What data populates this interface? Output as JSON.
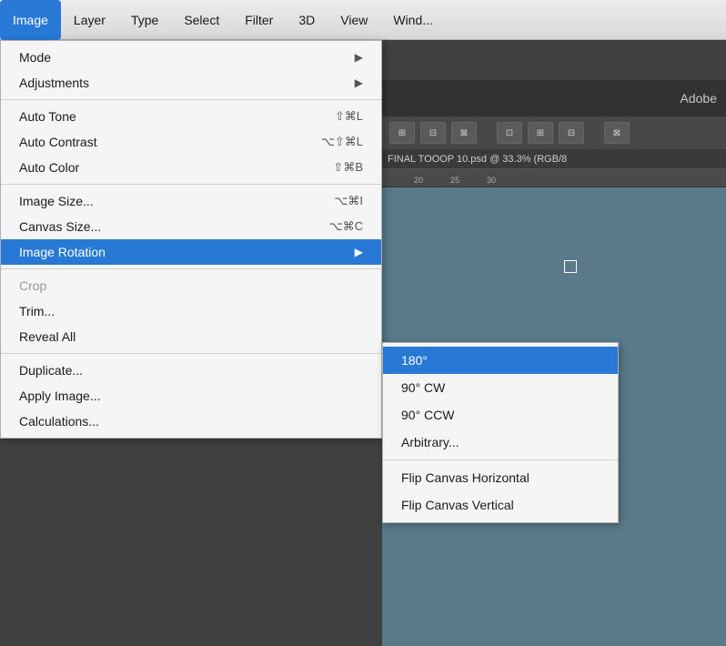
{
  "menubar": {
    "items": [
      {
        "label": "Image",
        "active": true
      },
      {
        "label": "Layer",
        "active": false
      },
      {
        "label": "Type",
        "active": false
      },
      {
        "label": "Select",
        "active": false
      },
      {
        "label": "Filter",
        "active": false
      },
      {
        "label": "3D",
        "active": false
      },
      {
        "label": "View",
        "active": false
      },
      {
        "label": "Wind...",
        "active": false
      }
    ]
  },
  "adobe_label": "Adobe",
  "file_info": "FINAL TOOOP 10.psd @ 33.3% (RGB/8",
  "ruler_marks": [
    "20",
    "25",
    "30"
  ],
  "image_menu": {
    "sections": [
      {
        "items": [
          {
            "label": "Mode",
            "shortcut": "",
            "arrow": true,
            "disabled": false
          },
          {
            "label": "Adjustments",
            "shortcut": "",
            "arrow": true,
            "disabled": false
          }
        ]
      },
      {
        "items": [
          {
            "label": "Auto Tone",
            "shortcut": "⇧⌘L",
            "arrow": false,
            "disabled": false
          },
          {
            "label": "Auto Contrast",
            "shortcut": "⌥⇧⌘L",
            "arrow": false,
            "disabled": false
          },
          {
            "label": "Auto Color",
            "shortcut": "⇧⌘B",
            "arrow": false,
            "disabled": false
          }
        ]
      },
      {
        "items": [
          {
            "label": "Image Size...",
            "shortcut": "⌥⌘I",
            "arrow": false,
            "disabled": false
          },
          {
            "label": "Canvas Size...",
            "shortcut": "⌥⌘C",
            "arrow": false,
            "disabled": false
          },
          {
            "label": "Image Rotation",
            "shortcut": "",
            "arrow": true,
            "disabled": false,
            "highlighted": true
          }
        ]
      },
      {
        "items": [
          {
            "label": "Crop",
            "shortcut": "",
            "arrow": false,
            "disabled": true
          },
          {
            "label": "Trim...",
            "shortcut": "",
            "arrow": false,
            "disabled": false
          },
          {
            "label": "Reveal All",
            "shortcut": "",
            "arrow": false,
            "disabled": false
          }
        ]
      },
      {
        "items": [
          {
            "label": "Duplicate...",
            "shortcut": "",
            "arrow": false,
            "disabled": false
          },
          {
            "label": "Apply Image...",
            "shortcut": "",
            "arrow": false,
            "disabled": false
          },
          {
            "label": "Calculations...",
            "shortcut": "",
            "arrow": false,
            "disabled": false
          }
        ]
      }
    ]
  },
  "submenu": {
    "items": [
      {
        "label": "180°",
        "highlighted": true
      },
      {
        "label": "90° CW",
        "highlighted": false
      },
      {
        "label": "90° CCW",
        "highlighted": false
      },
      {
        "label": "Arbitrary...",
        "highlighted": false
      }
    ],
    "divider_after": 3,
    "bottom_items": [
      {
        "label": "Flip Canvas Horizontal",
        "highlighted": false
      },
      {
        "label": "Flip Canvas Vertical",
        "highlighted": false
      }
    ]
  }
}
